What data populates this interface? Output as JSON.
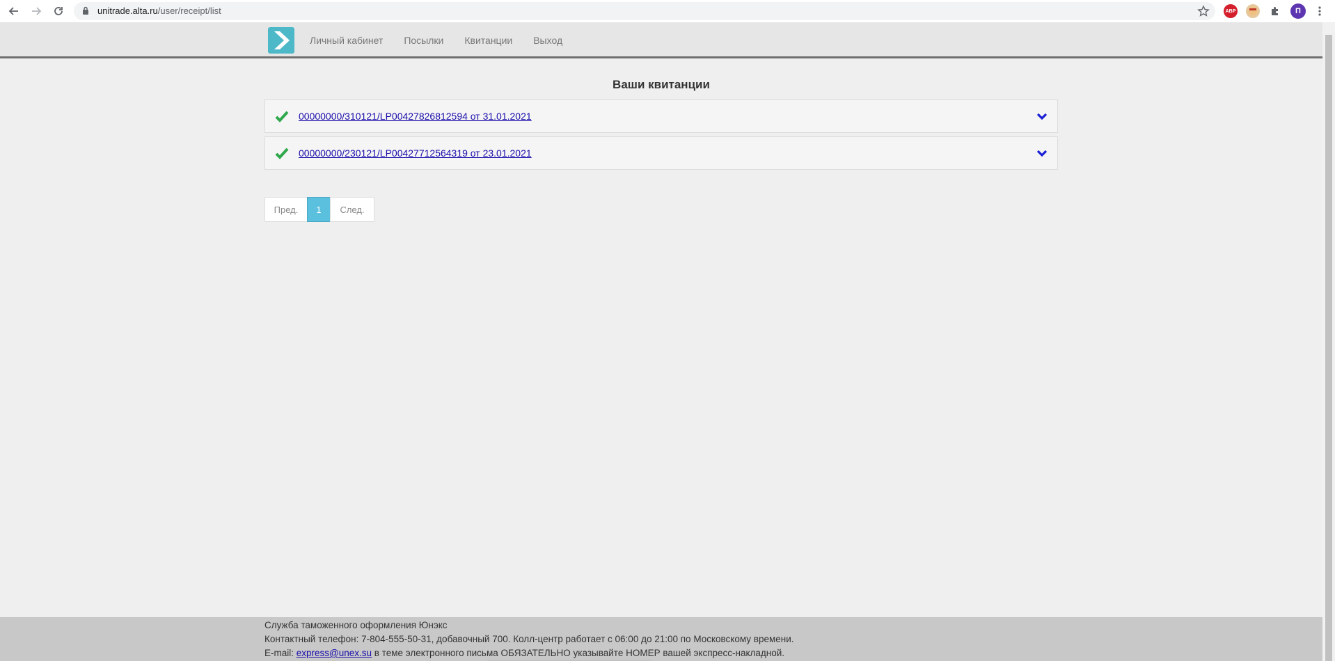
{
  "browser": {
    "url_host": "unitrade.alta.ru",
    "url_path": "/user/receipt/list",
    "profile_initial": "П",
    "ext_abp": "ABP"
  },
  "header": {
    "menu": [
      {
        "label": "Личный кабинет"
      },
      {
        "label": "Посылки"
      },
      {
        "label": "Квитанции"
      },
      {
        "label": "Выход"
      }
    ]
  },
  "main": {
    "title": "Ваши квитанции",
    "receipts": [
      {
        "label": "00000000/310121/LP00427826812594 от 31.01.2021"
      },
      {
        "label": "00000000/230121/LP00427712564319 от 23.01.2021"
      }
    ]
  },
  "pagination": {
    "prev": "Пред.",
    "current": "1",
    "next": "След."
  },
  "footer": {
    "line1": "Служба таможенного оформления Юнэкс",
    "line2": "Контактный телефон: 7-804-555-50-31, добавочный 700. Колл-центр работает с 06:00 до 21:00 по Московскому времени.",
    "email_prefix": "E-mail: ",
    "email": "express@unex.su",
    "email_suffix": " в теме электронного письма ОБЯЗАТЕЛЬНО указывайте НОМЕР вашей экспресс-накладной."
  },
  "colors": {
    "accent": "#5bc0de",
    "logo": "#4db8c8",
    "check": "#2ea84a",
    "chevron": "#1a1fd6"
  }
}
